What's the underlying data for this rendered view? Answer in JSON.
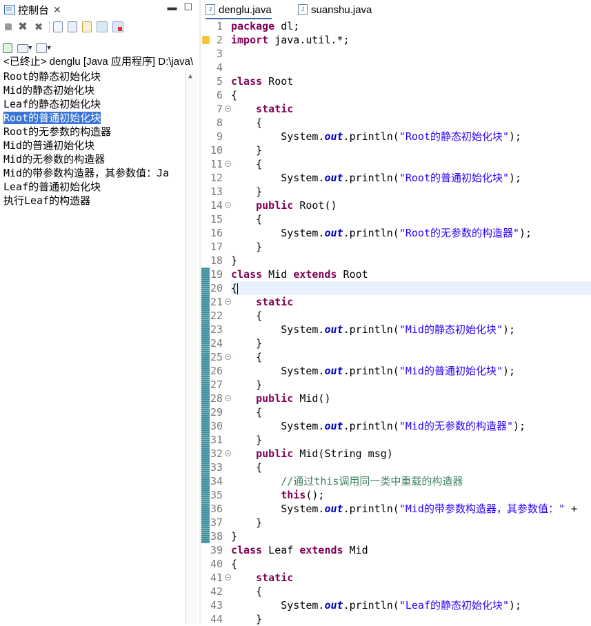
{
  "console_view": {
    "tab_label": "控制台",
    "header": "<已终止> denglu [Java 应用程序] D:\\java\\",
    "lines": [
      "Root的静态初始化块",
      "Mid的静态初始化块",
      "Leaf的静态初始化块",
      "Root的普通初始化块",
      "Root的无参数的构造器",
      "Mid的普通初始化块",
      "Mid的无参数的构造器",
      "Mid的带参数构造器，其参数值：Ja",
      "Leaf的普通初始化块",
      "执行Leaf的构造器"
    ],
    "selected_line": 3
  },
  "editor": {
    "tabs": [
      {
        "label": "denglu.java",
        "active": true
      },
      {
        "label": "suanshu.java",
        "active": false
      }
    ],
    "current_line": 20,
    "line_numbers": [
      "1",
      "2",
      "3",
      "4",
      "5",
      "6",
      "7",
      "8",
      "9",
      "10",
      "11",
      "12",
      "13",
      "14",
      "15",
      "16",
      "17",
      "18",
      "19",
      "20",
      "21",
      "22",
      "23",
      "24",
      "25",
      "26",
      "27",
      "28",
      "29",
      "30",
      "31",
      "32",
      "33",
      "34",
      "35",
      "36",
      "37",
      "38",
      "39",
      "40",
      "41",
      "42",
      "43",
      "44"
    ],
    "fold_markers": [
      7,
      11,
      14,
      21,
      25,
      28,
      32,
      41
    ],
    "code_lines": [
      [
        [
          "kw",
          "package"
        ],
        [
          "t",
          " dl;"
        ]
      ],
      [
        [
          "kw",
          "import"
        ],
        [
          "t",
          " java.util.*;"
        ]
      ],
      [
        [
          "t",
          ""
        ]
      ],
      [
        [
          "t",
          ""
        ]
      ],
      [
        [
          "kw",
          "class"
        ],
        [
          "t",
          " Root"
        ]
      ],
      [
        [
          "t",
          "{"
        ]
      ],
      [
        [
          "t",
          "    "
        ],
        [
          "kw",
          "static"
        ]
      ],
      [
        [
          "t",
          "    {"
        ]
      ],
      [
        [
          "t",
          "        System."
        ],
        [
          "fld",
          "out"
        ],
        [
          "t",
          ".println("
        ],
        [
          "str",
          "\"Root的静态初始化块\""
        ],
        [
          "t",
          ");"
        ]
      ],
      [
        [
          "t",
          "    }"
        ]
      ],
      [
        [
          "t",
          "    {"
        ]
      ],
      [
        [
          "t",
          "        System."
        ],
        [
          "fld",
          "out"
        ],
        [
          "t",
          ".println("
        ],
        [
          "str",
          "\"Root的普通初始化块\""
        ],
        [
          "t",
          ");"
        ]
      ],
      [
        [
          "t",
          "    }"
        ]
      ],
      [
        [
          "t",
          "    "
        ],
        [
          "kw",
          "public"
        ],
        [
          "t",
          " Root()"
        ]
      ],
      [
        [
          "t",
          "    {"
        ]
      ],
      [
        [
          "t",
          "        System."
        ],
        [
          "fld",
          "out"
        ],
        [
          "t",
          ".println("
        ],
        [
          "str",
          "\"Root的无参数的构造器\""
        ],
        [
          "t",
          ");"
        ]
      ],
      [
        [
          "t",
          "    }"
        ]
      ],
      [
        [
          "t",
          "}"
        ]
      ],
      [
        [
          "kw",
          "class"
        ],
        [
          "t",
          " Mid "
        ],
        [
          "kw",
          "extends"
        ],
        [
          "t",
          " Root"
        ]
      ],
      [
        [
          "t",
          "{"
        ]
      ],
      [
        [
          "t",
          "    "
        ],
        [
          "kw",
          "static"
        ]
      ],
      [
        [
          "t",
          "    {"
        ]
      ],
      [
        [
          "t",
          "        System."
        ],
        [
          "fld",
          "out"
        ],
        [
          "t",
          ".println("
        ],
        [
          "str",
          "\"Mid的静态初始化块\""
        ],
        [
          "t",
          ");"
        ]
      ],
      [
        [
          "t",
          "    }"
        ]
      ],
      [
        [
          "t",
          "    {"
        ]
      ],
      [
        [
          "t",
          "        System."
        ],
        [
          "fld",
          "out"
        ],
        [
          "t",
          ".println("
        ],
        [
          "str",
          "\"Mid的普通初始化块\""
        ],
        [
          "t",
          ");"
        ]
      ],
      [
        [
          "t",
          "    }"
        ]
      ],
      [
        [
          "t",
          "    "
        ],
        [
          "kw",
          "public"
        ],
        [
          "t",
          " Mid()"
        ]
      ],
      [
        [
          "t",
          "    {"
        ]
      ],
      [
        [
          "t",
          "        System."
        ],
        [
          "fld",
          "out"
        ],
        [
          "t",
          ".println("
        ],
        [
          "str",
          "\"Mid的无参数的构造器\""
        ],
        [
          "t",
          ");"
        ]
      ],
      [
        [
          "t",
          "    }"
        ]
      ],
      [
        [
          "t",
          "    "
        ],
        [
          "kw",
          "public"
        ],
        [
          "t",
          " Mid(String msg)"
        ]
      ],
      [
        [
          "t",
          "    {"
        ]
      ],
      [
        [
          "t",
          "        "
        ],
        [
          "cmt",
          "//通过this调用同一类中重载的构造器"
        ]
      ],
      [
        [
          "t",
          "        "
        ],
        [
          "kw",
          "this"
        ],
        [
          "t",
          "();"
        ]
      ],
      [
        [
          "t",
          "        System."
        ],
        [
          "fld",
          "out"
        ],
        [
          "t",
          ".println("
        ],
        [
          "str",
          "\"Mid的带参数构造器，其参数值：\""
        ],
        [
          "t",
          " +"
        ]
      ],
      [
        [
          "t",
          "    }"
        ]
      ],
      [
        [
          "t",
          "}"
        ]
      ],
      [
        [
          "kw",
          "class"
        ],
        [
          "t",
          " Leaf "
        ],
        [
          "kw",
          "extends"
        ],
        [
          "t",
          " Mid"
        ]
      ],
      [
        [
          "t",
          "{"
        ]
      ],
      [
        [
          "t",
          "    "
        ],
        [
          "kw",
          "static"
        ]
      ],
      [
        [
          "t",
          "    {"
        ]
      ],
      [
        [
          "t",
          "        System."
        ],
        [
          "fld",
          "out"
        ],
        [
          "t",
          ".println("
        ],
        [
          "str",
          "\"Leaf的静态初始化块\""
        ],
        [
          "t",
          ");"
        ]
      ],
      [
        [
          "t",
          "    }"
        ]
      ]
    ]
  }
}
